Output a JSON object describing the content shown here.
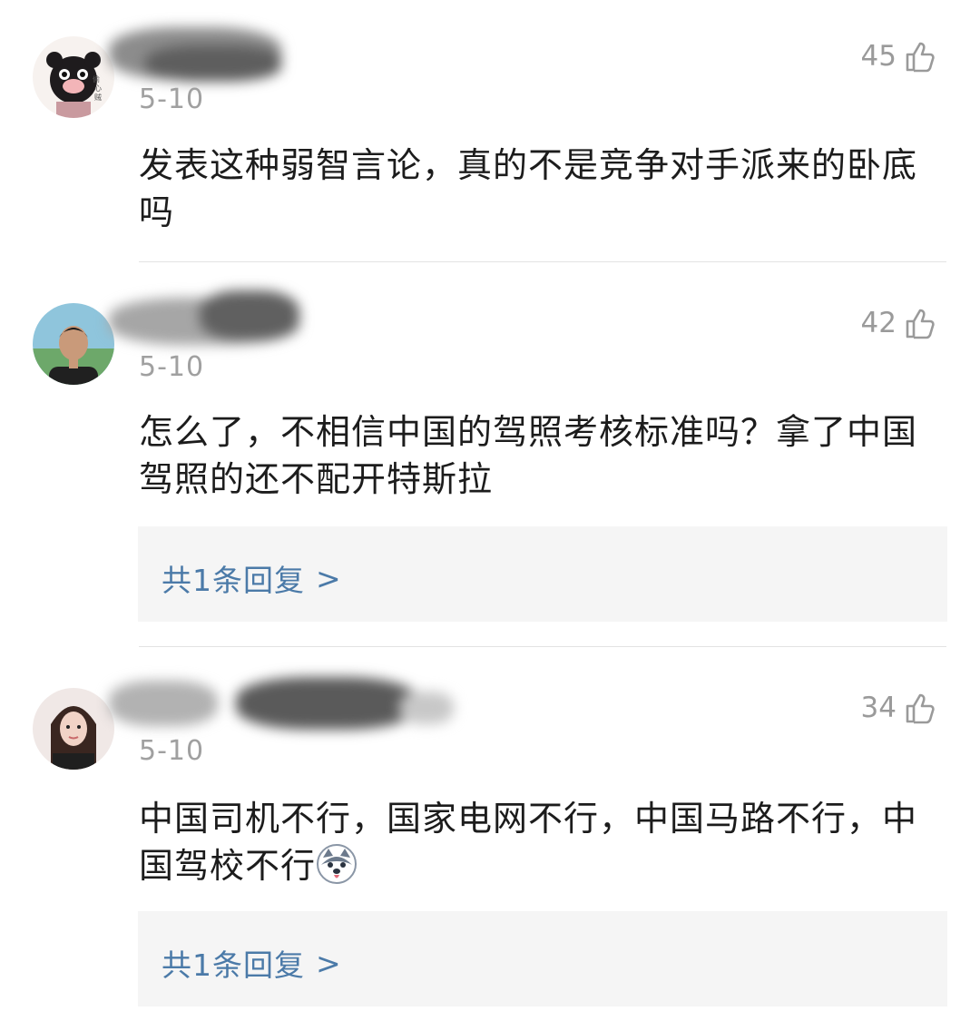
{
  "comments": [
    {
      "date": "5-10",
      "likes": "45",
      "text": "发表这种弱智言论，真的不是竞争对手派来的卧底吗",
      "avatar_icon": "cartoon-bear-avatar"
    },
    {
      "date": "5-10",
      "likes": "42",
      "text": "怎么了，不相信中国的驾照考核标准吗？拿了中国驾照的还不配开特斯拉",
      "reply_label": "共1条回复",
      "reply_arrow": ">",
      "avatar_icon": "young-man-avatar"
    },
    {
      "date": "5-10",
      "likes": "34",
      "text": "中国司机不行，国家电网不行，中国马路不行，中国驾校不行",
      "reply_label": "共1条回复",
      "reply_arrow": ">",
      "avatar_icon": "young-woman-avatar",
      "emoji_icon": "husky-dog-emoji"
    }
  ],
  "colors": {
    "link": "#4b7aa8",
    "meta": "#a0a0a0",
    "reply_bg": "#f5f5f5"
  },
  "icons": {
    "like": "thumbs-up-outline-icon"
  }
}
